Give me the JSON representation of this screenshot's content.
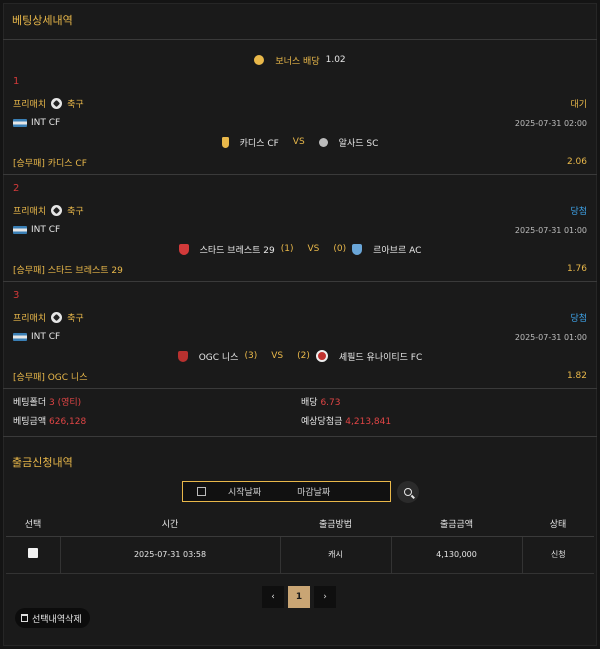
{
  "betting_detail": {
    "title": "베팅상세내역",
    "bonus_label": "보너스 배당",
    "bonus_value": "1.02",
    "bets": [
      {
        "index": "1",
        "type_label": "프리매치",
        "sport": "축구",
        "status": "대기",
        "league": "INT CF",
        "datetime": "2025-07-31 02:00",
        "home": "카디스 CF",
        "home_score": "",
        "vs": "VS",
        "away_score": "",
        "away": "알사드 SC",
        "pick": "[승무패] 카디스 CF",
        "odds": "2.06"
      },
      {
        "index": "2",
        "type_label": "프리매치",
        "sport": "축구",
        "status": "당첨",
        "league": "INT CF",
        "datetime": "2025-07-31 01:00",
        "home": "스타드 브레스트 29",
        "home_score": "(1)",
        "vs": "VS",
        "away_score": "(0)",
        "away": "르아브르 AC",
        "pick": "[승무패] 스타드 브레스트 29",
        "odds": "1.76"
      },
      {
        "index": "3",
        "type_label": "프리매치",
        "sport": "축구",
        "status": "당첨",
        "league": "INT CF",
        "datetime": "2025-07-31 01:00",
        "home": "OGC 니스",
        "home_score": "(3)",
        "vs": "VS",
        "away_score": "(2)",
        "away": "셰필드 유나이티드 FC",
        "pick": "[승무패] OGC 니스",
        "odds": "1.82"
      }
    ],
    "summary": {
      "folder_label": "베팅폴더",
      "folder_value": "3 (영티)",
      "odds_label": "배당",
      "odds_value": "6.73",
      "amount_label": "베팅금액",
      "amount_value": "626,128",
      "expected_label": "예상당첨금",
      "expected_value": "4,213,841"
    }
  },
  "withdrawal": {
    "title": "출금신청내역",
    "start_placeholder": "시작날짜",
    "end_placeholder": "마감날짜",
    "columns": [
      "선택",
      "시간",
      "출금방법",
      "출금금액",
      "상태"
    ],
    "rows": [
      {
        "time": "2025-07-31 03:58",
        "method": "캐시",
        "amount": "4,130,000",
        "status": "신청"
      }
    ],
    "pagination": {
      "prev": "‹",
      "current": "1",
      "next": "›"
    },
    "delete_button": "선택내역삭제"
  },
  "colors": {
    "accent": "#e9b84a",
    "win": "#3ea2e8",
    "index": "#d23a3a",
    "pending": "#e9b84a"
  }
}
